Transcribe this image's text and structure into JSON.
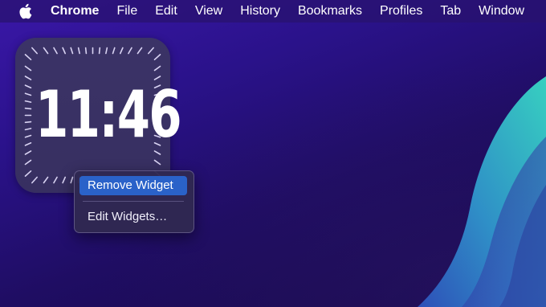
{
  "menubar": {
    "apple_icon": "apple-logo",
    "app_name": "Chrome",
    "items": [
      "File",
      "Edit",
      "View",
      "History",
      "Bookmarks",
      "Profiles",
      "Tab",
      "Window"
    ]
  },
  "widget": {
    "time": "11:46"
  },
  "context_menu": {
    "items": [
      {
        "label": "Remove Widget",
        "selected": true
      },
      {
        "label": "Edit Widgets…",
        "selected": false
      }
    ]
  },
  "colors": {
    "highlight": "#2a62c9",
    "wallpaper_accent": "#2fb6c8"
  }
}
